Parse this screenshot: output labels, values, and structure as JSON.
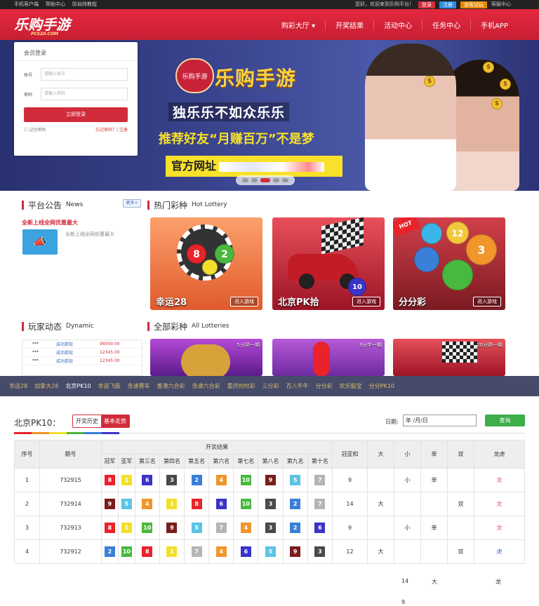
{
  "topbar": {
    "left": [
      "手机客户端",
      "帮助中心",
      "防劫持教程"
    ],
    "greeting": "您好，欢迎来到乐购平台！",
    "login": "登录",
    "register": "注册",
    "trial": "游客试玩",
    "service": "客服中心",
    "colors": {
      "login": "#d12c3b",
      "register": "#2d8ee0",
      "trial": "#e68a00"
    }
  },
  "header": {
    "logo": "乐购手游",
    "logo_sub": "PCS20.COM",
    "nav": [
      "购彩大厅",
      "开奖结果",
      "活动中心",
      "任务中心",
      "手机APP"
    ]
  },
  "login": {
    "title": "会员登录",
    "account_label": "账号",
    "account_placeholder": "请输入账号",
    "password_label": "密码",
    "password_placeholder": "请输入密码",
    "submit": "立即登录",
    "remember": "记住密码",
    "forgot": "忘记密码？",
    "register": "| 注册"
  },
  "banner": {
    "logo_text": "乐购手游",
    "title": "乐购手游",
    "line1": "独乐乐不如众乐乐",
    "line2": "推荐好友“月赚百万”不是梦",
    "url_label": "官方网址",
    "active_dot": 3
  },
  "notice": {
    "title": "平台公告",
    "title_en": "News",
    "more": "更多+",
    "link": "全新上线全网优惠最大",
    "text": "全新上线全网优惠最大"
  },
  "hot": {
    "title": "热门彩种",
    "title_en": "Hot Lottery",
    "enter": "进入游戏",
    "games": [
      "幸运28",
      "北京PK拾",
      "分分彩"
    ]
  },
  "dynamic": {
    "title": "玩家动态",
    "title_en": "Dynamic",
    "rows": [
      {
        "user": "***",
        "action": "成功提现",
        "amount": "96000.00"
      },
      {
        "user": "***",
        "action": "成功提现",
        "amount": "12345.00"
      },
      {
        "user": "***",
        "action": "成功提现",
        "amount": "12345.00"
      }
    ]
  },
  "all": {
    "title": "全部彩种",
    "title_en": "All Lotteries",
    "tags": [
      "5分钟一期",
      "3分半一期",
      "20分钟一期"
    ]
  },
  "strip": [
    "幸运28",
    "加拿大28",
    "北京PK10",
    "幸运飞艇",
    "急速赛车",
    "香港六合彩",
    "急速六合彩",
    "重庆时时彩",
    "三分彩",
    "百人牛牛",
    "分分彩",
    "欢乐骰宝",
    "分分PK10"
  ],
  "results": {
    "title": "北京PK10：",
    "tab_history": "开奖历史",
    "tab_trend": "基本走势",
    "date_label": "日期:",
    "date_value": "年 /月/日",
    "query": "查询",
    "head": {
      "index": "序号",
      "issue": "期号",
      "result": "开奖结果",
      "places": [
        "冠军",
        "亚军",
        "第三名",
        "第四名",
        "第五名",
        "第六名",
        "第七名",
        "第八名",
        "第九名",
        "第十名"
      ],
      "sum": "冠亚和",
      "big": "大",
      "small": "小",
      "odd": "单",
      "even": "双",
      "dragon": "龙虎"
    },
    "rows": [
      {
        "idx": "1",
        "issue": "732915",
        "nums": [
          8,
          1,
          6,
          3,
          2,
          4,
          10,
          9,
          5,
          7
        ],
        "sum": "9",
        "big": "",
        "small": "小",
        "odd": "单",
        "even": "",
        "dragon": "龙"
      },
      {
        "idx": "2",
        "issue": "732914",
        "nums": [
          9,
          5,
          4,
          1,
          8,
          6,
          10,
          3,
          2,
          7
        ],
        "sum": "14",
        "big": "大",
        "small": "",
        "odd": "",
        "even": "双",
        "dragon": "龙"
      },
      {
        "idx": "3",
        "issue": "732913",
        "nums": [
          8,
          1,
          10,
          9,
          5,
          7,
          4,
          3,
          2,
          6
        ],
        "sum": "9",
        "big": "",
        "small": "小",
        "odd": "单",
        "even": "",
        "dragon": "龙"
      },
      {
        "idx": "4",
        "issue": "732912",
        "nums": [
          2,
          10,
          8,
          1,
          7,
          4,
          6,
          5,
          9,
          3
        ],
        "sum": "12",
        "big": "大",
        "small": "",
        "odd": "",
        "even": "双",
        "dragon": "虎"
      }
    ],
    "overflow": [
      {
        "sum": "14",
        "big": "大",
        "dragon": "龙"
      },
      {
        "sum": "9"
      }
    ]
  },
  "ball_colors": {
    "1": "#f2e02a",
    "2": "#3a7fd8",
    "3": "#4a4a4a",
    "4": "#f0962a",
    "5": "#5cc3e4",
    "6": "#3a33c9",
    "7": "#b5b5b5",
    "8": "#e8232a",
    "9": "#7a1d1d",
    "10": "#49b83f"
  }
}
